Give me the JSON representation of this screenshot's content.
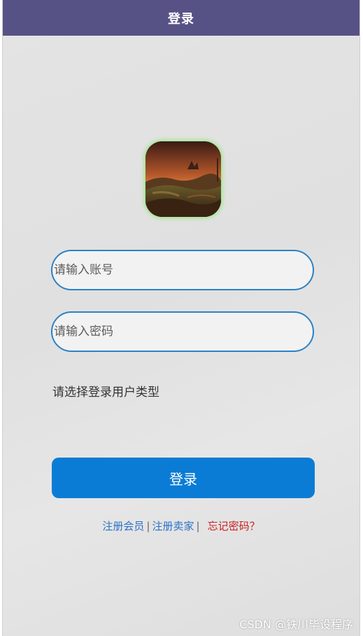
{
  "header": {
    "title": "登录"
  },
  "logo": {
    "icon": "landscape-logo",
    "glow_color": "#9be78b"
  },
  "form": {
    "account_placeholder": "请输入账号",
    "password_placeholder": "请输入密码",
    "usertype_label": "请选择登录用户类型",
    "login_label": "登录"
  },
  "links": {
    "register_member": "注册会员",
    "separator1": "|",
    "register_seller": "注册卖家",
    "separator2": "|",
    "forgot_password": "忘记密码？"
  },
  "watermark": "CSDN @铁川毕设程序",
  "colors": {
    "header_bg": "#575286",
    "input_border": "#2b82c6",
    "button_bg": "#0b7cd5",
    "link_blue": "#2a72c8",
    "link_red": "#cc1f1f"
  }
}
